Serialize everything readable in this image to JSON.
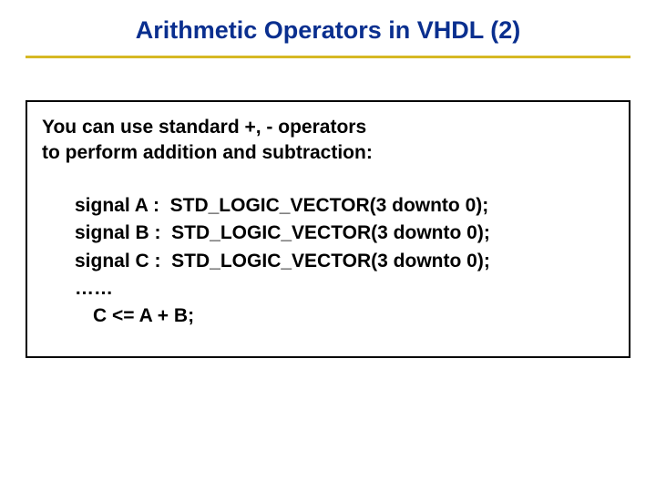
{
  "title": "Arithmetic Operators in VHDL (2)",
  "intro_line1": "You can use standard +, - operators",
  "intro_line2": "to perform addition and subtraction:",
  "code": {
    "decl1": "signal A :  STD_LOGIC_VECTOR(3 downto 0);",
    "decl2": "signal B :  STD_LOGIC_VECTOR(3 downto 0);",
    "decl3": "signal C :  STD_LOGIC_VECTOR(3 downto 0);",
    "ellipsis": "……",
    "assign": "C <= A + B;"
  }
}
